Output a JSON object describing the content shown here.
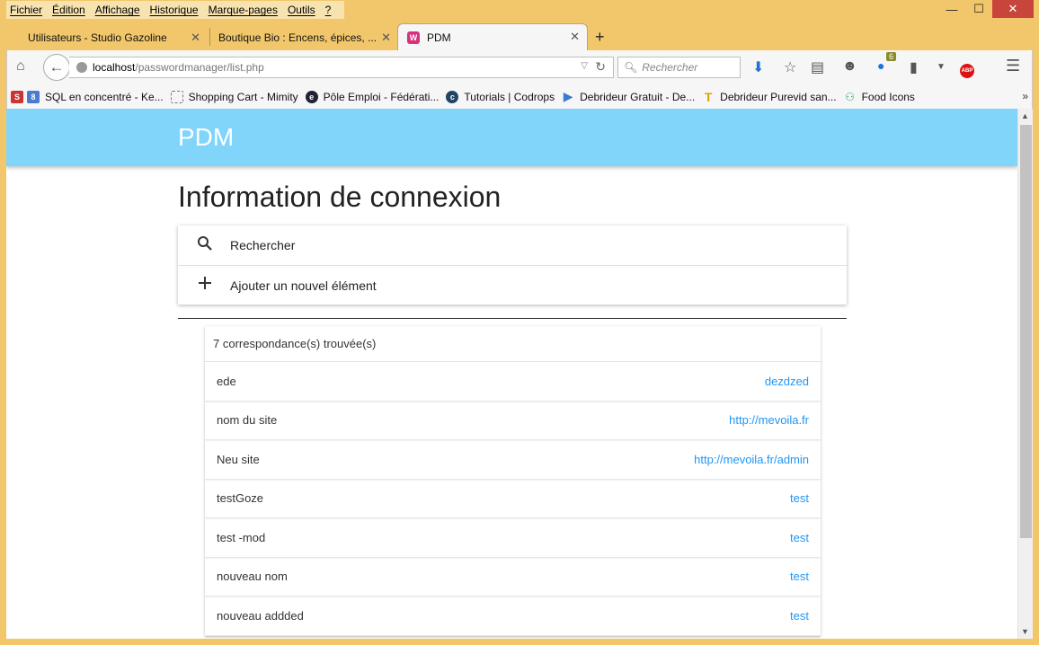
{
  "menubar": [
    "Fichier",
    "Édition",
    "Affichage",
    "Historique",
    "Marque-pages",
    "Outils",
    "?"
  ],
  "tabs": [
    {
      "label": "Utilisateurs - Studio Gazoline"
    },
    {
      "label": "Boutique Bio : Encens, épices, ..."
    },
    {
      "label": "PDM"
    }
  ],
  "address": {
    "host": "localhost",
    "path": "/passwordmanager/list.php"
  },
  "search_placeholder": "Rechercher",
  "badge_count": "6",
  "bookmarks": [
    "SQL en concentré - Ke...",
    "Shopping Cart - Mimity",
    "Pôle Emploi - Fédérati...",
    "Tutorials | Codrops",
    "Debrideur Gratuit - De...",
    "Debrideur Purevid san...",
    "Food Icons"
  ],
  "app": {
    "brand": "PDM",
    "title": "Information de connexion",
    "search_label": "Rechercher",
    "add_label": "Ajouter un nouvel élément",
    "results_header": "7 correspondance(s) trouvée(s)",
    "rows": [
      {
        "name": "ede",
        "url": "dezdzed"
      },
      {
        "name": "nom du site",
        "url": "http://mevoila.fr"
      },
      {
        "name": "Neu site",
        "url": "http://mevoila.fr/admin"
      },
      {
        "name": "testGoze",
        "url": "test"
      },
      {
        "name": "test -mod",
        "url": "test"
      },
      {
        "name": "nouveau nom",
        "url": "test"
      },
      {
        "name": "nouveau addded",
        "url": "test"
      }
    ]
  },
  "colors": {
    "appbar": "#81d4fa",
    "link": "#2196f3",
    "frame": "#f2c76b"
  }
}
